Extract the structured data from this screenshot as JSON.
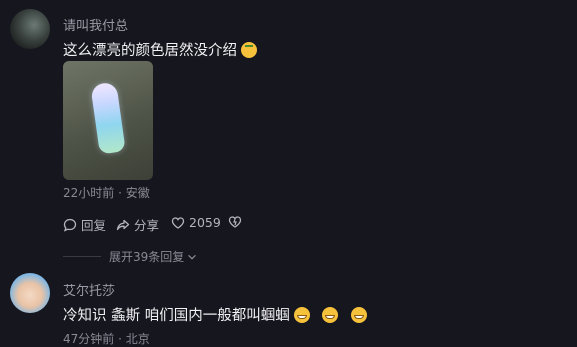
{
  "comments": [
    {
      "username": "请叫我付总",
      "text": "这么漂亮的颜色居然没介绍",
      "meta": "22小时前 · 安徽",
      "actions": {
        "reply_label": "回复",
        "share_label": "分享",
        "like_count": "2059"
      },
      "expand_label": "展开39条回复",
      "icons": [
        "comment-icon",
        "share-icon",
        "heart-icon",
        "dislike-icon",
        "chevron-down-icon"
      ]
    },
    {
      "username": "艾尔托莎",
      "text": "冷知识 螽斯 咱们国内一般都叫蝈蝈",
      "meta": "47分钟前 · 北京"
    }
  ],
  "colors": {
    "background": "#16161e",
    "text_primary": "#f2f2f5",
    "text_secondary": "#9a9aa6"
  }
}
